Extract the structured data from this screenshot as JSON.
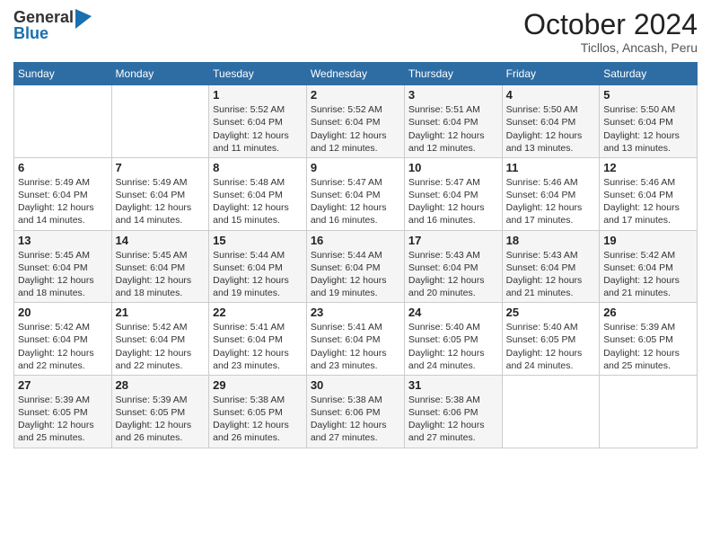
{
  "logo": {
    "general": "General",
    "blue": "Blue"
  },
  "header": {
    "month": "October 2024",
    "location": "Ticllos, Ancash, Peru"
  },
  "weekdays": [
    "Sunday",
    "Monday",
    "Tuesday",
    "Wednesday",
    "Thursday",
    "Friday",
    "Saturday"
  ],
  "weeks": [
    [
      {
        "day": "",
        "sunrise": "",
        "sunset": "",
        "daylight": ""
      },
      {
        "day": "",
        "sunrise": "",
        "sunset": "",
        "daylight": ""
      },
      {
        "day": "1",
        "sunrise": "Sunrise: 5:52 AM",
        "sunset": "Sunset: 6:04 PM",
        "daylight": "Daylight: 12 hours and 11 minutes."
      },
      {
        "day": "2",
        "sunrise": "Sunrise: 5:52 AM",
        "sunset": "Sunset: 6:04 PM",
        "daylight": "Daylight: 12 hours and 12 minutes."
      },
      {
        "day": "3",
        "sunrise": "Sunrise: 5:51 AM",
        "sunset": "Sunset: 6:04 PM",
        "daylight": "Daylight: 12 hours and 12 minutes."
      },
      {
        "day": "4",
        "sunrise": "Sunrise: 5:50 AM",
        "sunset": "Sunset: 6:04 PM",
        "daylight": "Daylight: 12 hours and 13 minutes."
      },
      {
        "day": "5",
        "sunrise": "Sunrise: 5:50 AM",
        "sunset": "Sunset: 6:04 PM",
        "daylight": "Daylight: 12 hours and 13 minutes."
      }
    ],
    [
      {
        "day": "6",
        "sunrise": "Sunrise: 5:49 AM",
        "sunset": "Sunset: 6:04 PM",
        "daylight": "Daylight: 12 hours and 14 minutes."
      },
      {
        "day": "7",
        "sunrise": "Sunrise: 5:49 AM",
        "sunset": "Sunset: 6:04 PM",
        "daylight": "Daylight: 12 hours and 14 minutes."
      },
      {
        "day": "8",
        "sunrise": "Sunrise: 5:48 AM",
        "sunset": "Sunset: 6:04 PM",
        "daylight": "Daylight: 12 hours and 15 minutes."
      },
      {
        "day": "9",
        "sunrise": "Sunrise: 5:47 AM",
        "sunset": "Sunset: 6:04 PM",
        "daylight": "Daylight: 12 hours and 16 minutes."
      },
      {
        "day": "10",
        "sunrise": "Sunrise: 5:47 AM",
        "sunset": "Sunset: 6:04 PM",
        "daylight": "Daylight: 12 hours and 16 minutes."
      },
      {
        "day": "11",
        "sunrise": "Sunrise: 5:46 AM",
        "sunset": "Sunset: 6:04 PM",
        "daylight": "Daylight: 12 hours and 17 minutes."
      },
      {
        "day": "12",
        "sunrise": "Sunrise: 5:46 AM",
        "sunset": "Sunset: 6:04 PM",
        "daylight": "Daylight: 12 hours and 17 minutes."
      }
    ],
    [
      {
        "day": "13",
        "sunrise": "Sunrise: 5:45 AM",
        "sunset": "Sunset: 6:04 PM",
        "daylight": "Daylight: 12 hours and 18 minutes."
      },
      {
        "day": "14",
        "sunrise": "Sunrise: 5:45 AM",
        "sunset": "Sunset: 6:04 PM",
        "daylight": "Daylight: 12 hours and 18 minutes."
      },
      {
        "day": "15",
        "sunrise": "Sunrise: 5:44 AM",
        "sunset": "Sunset: 6:04 PM",
        "daylight": "Daylight: 12 hours and 19 minutes."
      },
      {
        "day": "16",
        "sunrise": "Sunrise: 5:44 AM",
        "sunset": "Sunset: 6:04 PM",
        "daylight": "Daylight: 12 hours and 19 minutes."
      },
      {
        "day": "17",
        "sunrise": "Sunrise: 5:43 AM",
        "sunset": "Sunset: 6:04 PM",
        "daylight": "Daylight: 12 hours and 20 minutes."
      },
      {
        "day": "18",
        "sunrise": "Sunrise: 5:43 AM",
        "sunset": "Sunset: 6:04 PM",
        "daylight": "Daylight: 12 hours and 21 minutes."
      },
      {
        "day": "19",
        "sunrise": "Sunrise: 5:42 AM",
        "sunset": "Sunset: 6:04 PM",
        "daylight": "Daylight: 12 hours and 21 minutes."
      }
    ],
    [
      {
        "day": "20",
        "sunrise": "Sunrise: 5:42 AM",
        "sunset": "Sunset: 6:04 PM",
        "daylight": "Daylight: 12 hours and 22 minutes."
      },
      {
        "day": "21",
        "sunrise": "Sunrise: 5:42 AM",
        "sunset": "Sunset: 6:04 PM",
        "daylight": "Daylight: 12 hours and 22 minutes."
      },
      {
        "day": "22",
        "sunrise": "Sunrise: 5:41 AM",
        "sunset": "Sunset: 6:04 PM",
        "daylight": "Daylight: 12 hours and 23 minutes."
      },
      {
        "day": "23",
        "sunrise": "Sunrise: 5:41 AM",
        "sunset": "Sunset: 6:04 PM",
        "daylight": "Daylight: 12 hours and 23 minutes."
      },
      {
        "day": "24",
        "sunrise": "Sunrise: 5:40 AM",
        "sunset": "Sunset: 6:05 PM",
        "daylight": "Daylight: 12 hours and 24 minutes."
      },
      {
        "day": "25",
        "sunrise": "Sunrise: 5:40 AM",
        "sunset": "Sunset: 6:05 PM",
        "daylight": "Daylight: 12 hours and 24 minutes."
      },
      {
        "day": "26",
        "sunrise": "Sunrise: 5:39 AM",
        "sunset": "Sunset: 6:05 PM",
        "daylight": "Daylight: 12 hours and 25 minutes."
      }
    ],
    [
      {
        "day": "27",
        "sunrise": "Sunrise: 5:39 AM",
        "sunset": "Sunset: 6:05 PM",
        "daylight": "Daylight: 12 hours and 25 minutes."
      },
      {
        "day": "28",
        "sunrise": "Sunrise: 5:39 AM",
        "sunset": "Sunset: 6:05 PM",
        "daylight": "Daylight: 12 hours and 26 minutes."
      },
      {
        "day": "29",
        "sunrise": "Sunrise: 5:38 AM",
        "sunset": "Sunset: 6:05 PM",
        "daylight": "Daylight: 12 hours and 26 minutes."
      },
      {
        "day": "30",
        "sunrise": "Sunrise: 5:38 AM",
        "sunset": "Sunset: 6:06 PM",
        "daylight": "Daylight: 12 hours and 27 minutes."
      },
      {
        "day": "31",
        "sunrise": "Sunrise: 5:38 AM",
        "sunset": "Sunset: 6:06 PM",
        "daylight": "Daylight: 12 hours and 27 minutes."
      },
      {
        "day": "",
        "sunrise": "",
        "sunset": "",
        "daylight": ""
      },
      {
        "day": "",
        "sunrise": "",
        "sunset": "",
        "daylight": ""
      }
    ]
  ]
}
